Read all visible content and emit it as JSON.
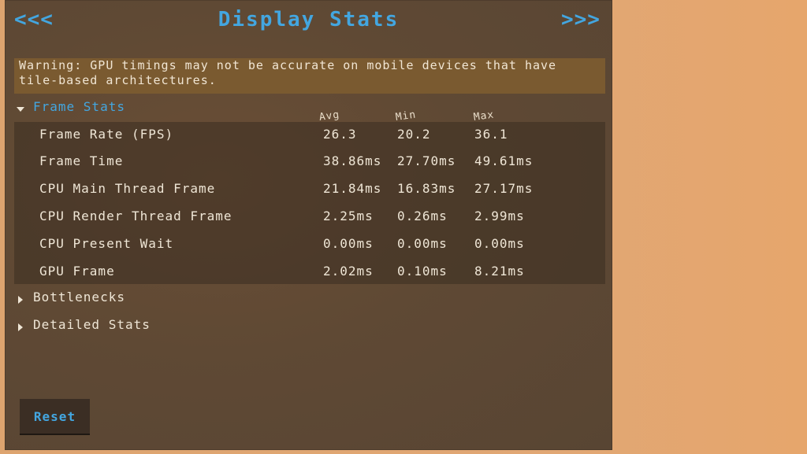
{
  "nav": {
    "prev_label": "<<<",
    "next_label": ">>>"
  },
  "title": "Display Stats",
  "warning": "Warning: GPU timings may not be accurate on mobile devices that have tile-based architectures.",
  "frame_stats": {
    "label": "Frame Stats",
    "expanded": true,
    "columns": {
      "avg": "Avg",
      "min": "Min",
      "max": "Max"
    },
    "rows": [
      {
        "label": "Frame Rate (FPS)",
        "avg": "26.3",
        "min": "20.2",
        "max": "36.1"
      },
      {
        "label": "Frame Time",
        "avg": "38.86ms",
        "min": "27.70ms",
        "max": "49.61ms"
      },
      {
        "label": "CPU Main Thread Frame",
        "avg": "21.84ms",
        "min": "16.83ms",
        "max": "27.17ms"
      },
      {
        "label": "CPU Render Thread Frame",
        "avg": "2.25ms",
        "min": "0.26ms",
        "max": "2.99ms"
      },
      {
        "label": "CPU Present Wait",
        "avg": "0.00ms",
        "min": "0.00ms",
        "max": "0.00ms"
      },
      {
        "label": "GPU Frame",
        "avg": "2.02ms",
        "min": "0.10ms",
        "max": "8.21ms"
      }
    ]
  },
  "bottlenecks": {
    "label": "Bottlenecks",
    "expanded": false
  },
  "detailed_stats": {
    "label": "Detailed Stats",
    "expanded": false
  },
  "reset_label": "Reset",
  "colors": {
    "accent": "#43a6e0",
    "panel": "#5f4934",
    "warning_bg": "#7a5a30",
    "text": "#efe6d6",
    "backdrop": "#e2a66f"
  },
  "icons": {
    "expanded": "triangle-down-icon",
    "collapsed": "triangle-right-icon"
  }
}
